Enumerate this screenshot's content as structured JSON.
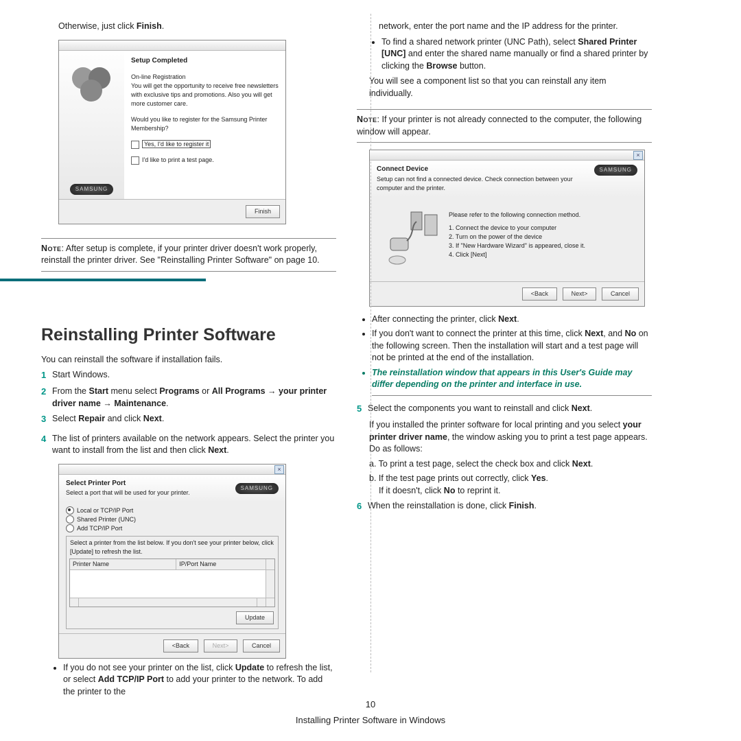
{
  "col1": {
    "intro": "Otherwise, just click ",
    "intro_b": "Finish",
    "intro_end": ".",
    "dlg1": {
      "title": "Setup Completed",
      "sub1": "On-line Registration",
      "sub2": "You will get the opportunity to receive free newsletters with exclusive tips and promotions. Also you will get more customer care.",
      "q": "Would you like to register for the Samsung Printer Membership?",
      "chk1": "Yes, I'd like to register it",
      "chk2": "I'd like to print a test page.",
      "btn": "Finish",
      "logo": "SAMSUNG"
    },
    "note1_label": "Note",
    "note1": ": After setup is complete, if your printer driver doesn't work properly, reinstall the printer driver. See \"Reinstalling Printer Software\" on page 10.",
    "h2": "Reinstalling Printer Software",
    "p_after_h2": "You can reinstall the software if installation fails.",
    "step1": "Start Windows.",
    "step2_a": "From the ",
    "step2_b": "Start",
    "step2_c": " menu select ",
    "step2_d": "Programs",
    "step2_e": " or ",
    "step2_f": "All Programs",
    "step2_g": " → ",
    "step2_h": "your printer driver name",
    "step2_i": " → ",
    "step2_j": "Maintenance",
    "step2_k": ".",
    "step3_a": "Select ",
    "step3_b": "Repair",
    "step3_c": " and click ",
    "step3_d": "Next",
    "step3_e": ".",
    "step4_a": "The list of printers available on the network appears. Select the printer you want to install from the list and then click ",
    "step4_b": "Next",
    "step4_c": ".",
    "dlg2": {
      "title": "Select Printer Port",
      "sub": "Select a port that will be used for your printer.",
      "opt1": "Local or TCP/IP Port",
      "opt2": "Shared Printer (UNC)",
      "opt3": "Add TCP/IP Port",
      "tip": "Select a printer from the list below. If you don't see your printer below, click [Update] to refresh the list.",
      "colA": "Printer Name",
      "colB": "IP/Port Name",
      "btnUpdate": "Update",
      "btnBack": "<Back",
      "btnNext": "Next>",
      "btnCancel": "Cancel",
      "logo": "SAMSUNG"
    },
    "bullet1_a": "If you do not see your printer on the list, click ",
    "bullet1_b": "Update",
    "bullet1_c": " to refresh the list, or select ",
    "bullet1_d": "Add TCP/IP Port",
    "bullet1_e": " to add your printer to the network. To add the printer to the"
  },
  "col2": {
    "cont": "network, enter the port name and the IP address for the printer.",
    "bullet2_a": "To find a shared network printer (UNC Path), select ",
    "bullet2_b": "Shared Printer [UNC]",
    "bullet2_c": " and enter the shared name manually or find a shared printer by clicking the ",
    "bullet2_d": "Browse",
    "bullet2_e": " button.",
    "p2": "You will see a component list so that you can reinstall any item individually.",
    "note2_label": "Note",
    "note2": ": If your printer is not already connected to the computer, the following window will appear.",
    "dlg3": {
      "title": "Connect Device",
      "sub": "Setup can not find a connected device. Check connection between your computer and the printer.",
      "l0": "Please refer to the following connection method.",
      "l1": "1. Connect the device to your computer",
      "l2": "2. Turn on the power of the device",
      "l3": "3. If \"New Hardware Wizard\" is appeared, close it.",
      "l4": "4. Click [Next]",
      "btnBack": "<Back",
      "btnNext": "Next>",
      "btnCancel": "Cancel",
      "logo": "SAMSUNG"
    },
    "bullet3_a": "After connecting the printer, click ",
    "bullet3_b": "Next",
    "bullet3_c": ".",
    "bullet4_a": "If you don't want to connect the printer at this time, click ",
    "bullet4_b": "Next",
    "bullet4_c": ", and ",
    "bullet4_d": "No",
    "bullet4_e": " on the following screen. Then the installation will start and a test page will not be printed at the end of the installation.",
    "greenBullet": "The reinstallation window that appears in this User's Guide may differ depending on the printer and interface in use.",
    "step5_a": "Select the components you want to reinstall and click ",
    "step5_b": "Next",
    "step5_c": ".",
    "step5_p_a": "If you installed the printer software for local printing and you select ",
    "step5_p_b": "your printer driver name",
    "step5_p_c": ", the window asking you to print a test page appears. Do as follows:",
    "sub_a_a": "a. To print a test page, select the check box and click ",
    "sub_a_b": "Next",
    "sub_a_c": ".",
    "sub_b_a": "b. If the test page prints out correctly, click ",
    "sub_b_b": "Yes",
    "sub_b_c": ".",
    "sub_b2_a": "If it doesn't, click ",
    "sub_b2_b": "No",
    "sub_b2_c": " to reprint it.",
    "step6_a": "When the reinstallation is done, click ",
    "step6_b": "Finish",
    "step6_c": "."
  },
  "footer": {
    "page": "10",
    "title": "Installing Printer Software in Windows"
  }
}
